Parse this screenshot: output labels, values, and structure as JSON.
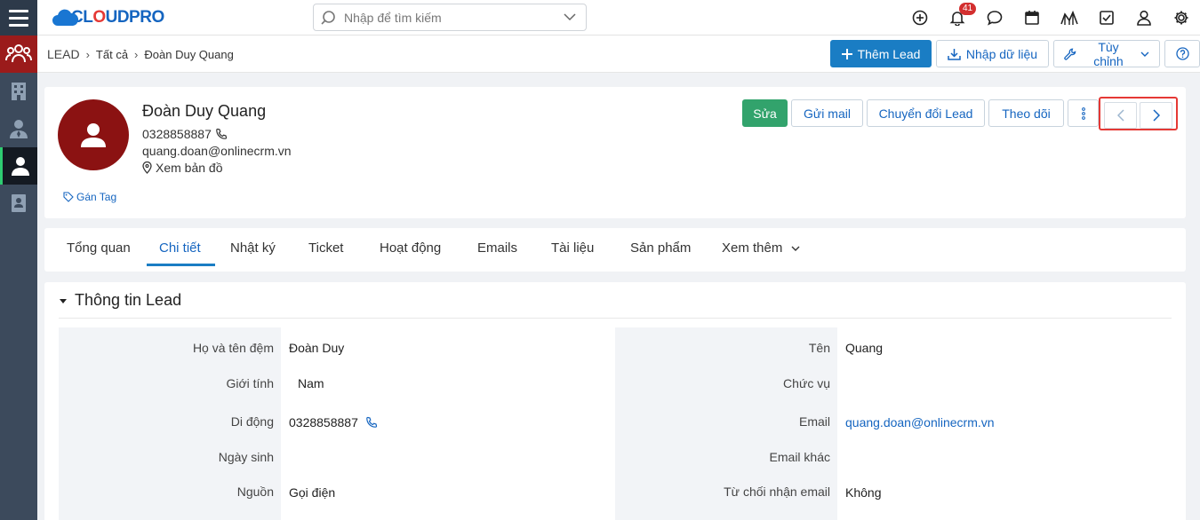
{
  "app": {
    "logo_prefix": "CL",
    "logo_o": "O",
    "logo_suffix": "UDPRO",
    "search_placeholder": "Nhập để tìm kiếm",
    "notification_count": "41"
  },
  "breadcrumb": {
    "module": "LEAD",
    "filter": "Tất cả",
    "record": "Đoàn Duy Quang"
  },
  "header_actions": {
    "add": "Thêm Lead",
    "import": "Nhập dữ liệu",
    "customize": "Tùy chỉnh"
  },
  "profile": {
    "name": "Đoàn Duy Quang",
    "phone": "0328858887",
    "email": "quang.doan@onlinecrm.vn",
    "map": "Xem bản đồ",
    "tag": "Gán Tag"
  },
  "record_actions": {
    "edit": "Sửa",
    "send_mail": "Gửi mail",
    "convert": "Chuyển đổi Lead",
    "follow": "Theo dõi"
  },
  "tabs": [
    "Tổng quan",
    "Chi tiết",
    "Nhật ký",
    "Ticket",
    "Hoạt động",
    "Emails",
    "Tài liệu",
    "Sản phẩm",
    "Xem thêm"
  ],
  "active_tab": "Chi tiết",
  "section": {
    "title": "Thông tin Lead",
    "left": [
      {
        "label": "Họ và tên đệm",
        "value": "Đoàn Duy"
      },
      {
        "label": "Giới tính",
        "value": "Nam"
      },
      {
        "label": "Di động",
        "value": "0328858887"
      },
      {
        "label": "Ngày sinh",
        "value": ""
      },
      {
        "label": "Nguồn",
        "value": "Gọi điện"
      }
    ],
    "right": [
      {
        "label": "Tên",
        "value": "Quang"
      },
      {
        "label": "Chức vụ",
        "value": ""
      },
      {
        "label": "Email",
        "value": "quang.doan@onlinecrm.vn"
      },
      {
        "label": "Email khác",
        "value": ""
      },
      {
        "label": "Từ chối nhận email",
        "value": "Không"
      }
    ]
  },
  "colors": {
    "primary": "#1a7dc4",
    "edit_green": "#32a36c",
    "avatar_red": "#8b1212",
    "highlight_red": "#e53935",
    "rail": "#3c4a5c"
  }
}
